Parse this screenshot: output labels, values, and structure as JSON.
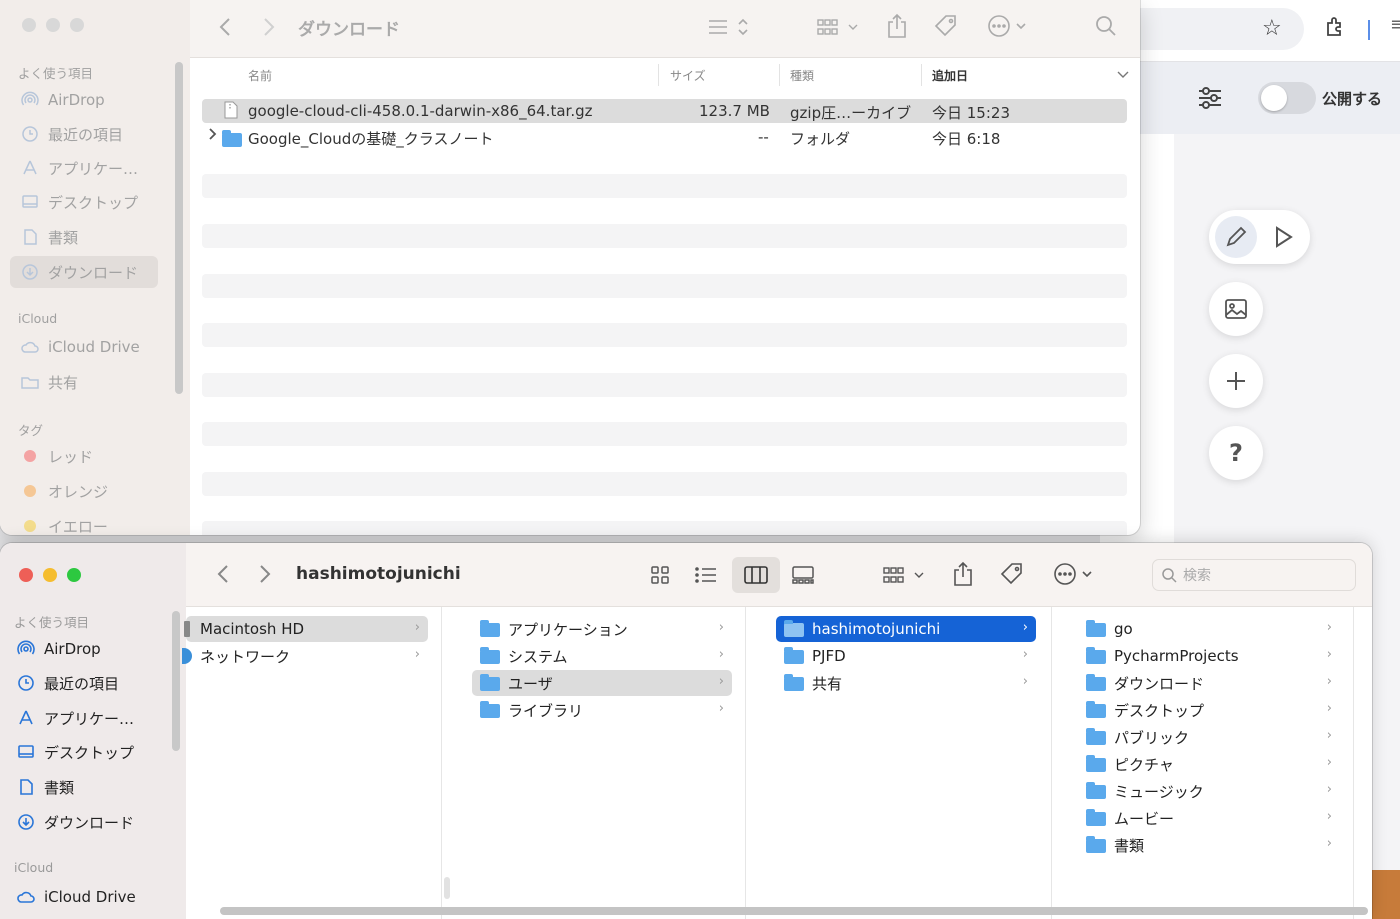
{
  "browser": {
    "publish_label": "公開する"
  },
  "finder_top": {
    "title": "ダウンロード",
    "sidebar": {
      "favorites_header": "よく使う項目",
      "items": [
        {
          "label": "AirDrop",
          "icon": "airdrop-icon"
        },
        {
          "label": "最近の項目",
          "icon": "clock-icon"
        },
        {
          "label": "アプリケー…",
          "icon": "applications-icon"
        },
        {
          "label": "デスクトップ",
          "icon": "desktop-icon"
        },
        {
          "label": "書類",
          "icon": "document-icon"
        },
        {
          "label": "ダウンロード",
          "icon": "download-icon"
        }
      ],
      "icloud_header": "iCloud",
      "icloud_items": [
        {
          "label": "iCloud Drive",
          "icon": "cloud-icon"
        },
        {
          "label": "共有",
          "icon": "shared-folder-icon"
        }
      ],
      "tags_header": "タグ",
      "tags": [
        {
          "label": "レッド",
          "color": "#f4a3a3"
        },
        {
          "label": "オレンジ",
          "color": "#f5c795"
        },
        {
          "label": "イエロー",
          "color": "#f3dc8c"
        }
      ]
    },
    "columns": {
      "name": "名前",
      "size": "サイズ",
      "kind": "種類",
      "date": "追加日"
    },
    "files": [
      {
        "name": "google-cloud-cli-458.0.1-darwin-x86_64.tar.gz",
        "size": "123.7 MB",
        "kind": "gzip圧…ーカイブ",
        "date": "今日 15:23"
      },
      {
        "name": "Google_Cloudの基礎_クラスノート",
        "size": "--",
        "kind": "フォルダ",
        "date": "今日 6:18"
      }
    ]
  },
  "finder_bottom": {
    "title": "hashimotojunichi",
    "search_placeholder": "検索",
    "sidebar": {
      "favorites_header": "よく使う項目",
      "items": [
        {
          "label": "AirDrop",
          "icon": "airdrop-icon"
        },
        {
          "label": "最近の項目",
          "icon": "clock-icon"
        },
        {
          "label": "アプリケー…",
          "icon": "applications-icon"
        },
        {
          "label": "デスクトップ",
          "icon": "desktop-icon"
        },
        {
          "label": "書類",
          "icon": "document-icon"
        },
        {
          "label": "ダウンロード",
          "icon": "download-icon"
        }
      ],
      "icloud_header": "iCloud",
      "icloud_items": [
        {
          "label": "iCloud Drive",
          "icon": "cloud-icon"
        }
      ]
    },
    "col1": [
      "Macintosh HD",
      "ネットワーク"
    ],
    "col2": [
      "アプリケーション",
      "システム",
      "ユーザ",
      "ライブラリ"
    ],
    "col3": [
      "hashimotojunichi",
      "PJFD",
      "共有"
    ],
    "col4": [
      "go",
      "PycharmProjects",
      "ダウンロード",
      "デスクトップ",
      "パブリック",
      "ピクチャ",
      "ミュージック",
      "ムービー",
      "書類"
    ]
  }
}
